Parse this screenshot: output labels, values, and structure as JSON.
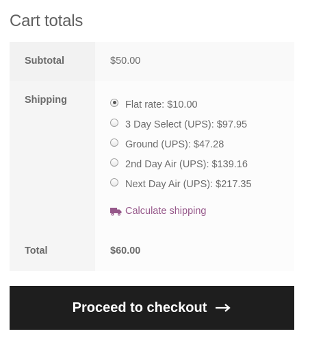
{
  "cart_totals": {
    "title": "Cart totals",
    "subtotal": {
      "label": "Subtotal",
      "value": "$50.00"
    },
    "shipping": {
      "label": "Shipping",
      "options": [
        {
          "label": "Flat rate: $10.00",
          "checked": true
        },
        {
          "label": "3 Day Select (UPS): $97.95",
          "checked": false
        },
        {
          "label": "Ground (UPS): $47.28",
          "checked": false
        },
        {
          "label": "2nd Day Air (UPS): $139.16",
          "checked": false
        },
        {
          "label": "Next Day Air (UPS): $217.35",
          "checked": false
        }
      ],
      "calculate_link": "Calculate shipping",
      "calculate_icon": "truck-icon"
    },
    "total": {
      "label": "Total",
      "value": "$60.00"
    },
    "checkout_button": {
      "label": "Proceed to checkout",
      "icon": "arrow-right-icon"
    }
  },
  "colors": {
    "link": "#96588a",
    "button_bg": "#1e1e1e",
    "button_text": "#ffffff"
  }
}
